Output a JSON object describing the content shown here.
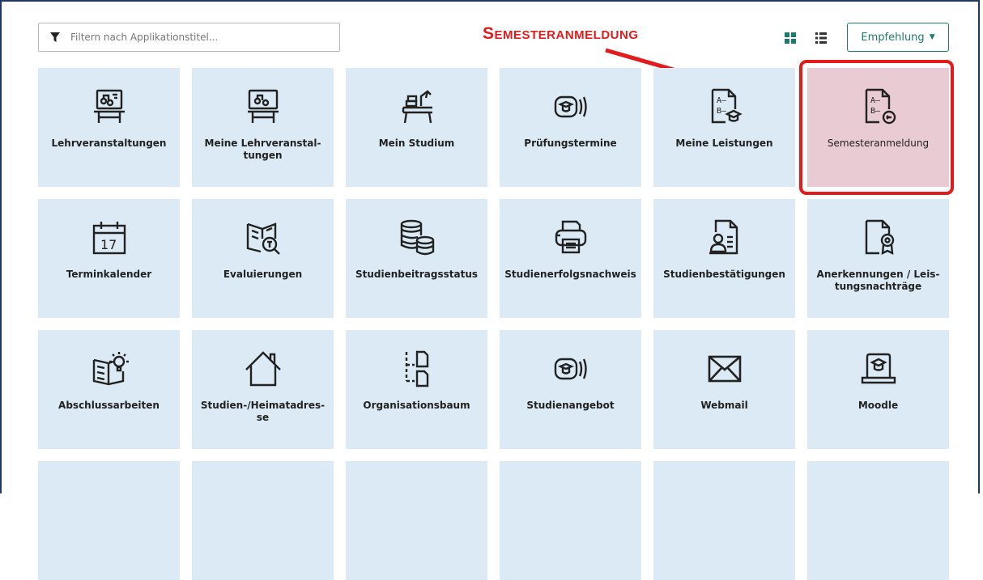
{
  "filter": {
    "placeholder": "Filtern nach Applikationstitel..."
  },
  "annotation": {
    "callout": "Semesteranmeldung"
  },
  "toolbar": {
    "sort_label": "Empfehlung"
  },
  "colors": {
    "tile": "#dbeaf4",
    "highlight_tile": "#e8cbd3",
    "annotation": "#e31b1b",
    "accent": "#1e7a6e"
  },
  "tiles": [
    {
      "label": "Lehrveranstaltungen",
      "icon": "lecture-board-icon"
    },
    {
      "label": "Meine Lehrveranstal-tungen",
      "icon": "my-lecture-board-icon"
    },
    {
      "label": "Mein Studium",
      "icon": "study-desk-icon"
    },
    {
      "label": "Prüfungstermine",
      "icon": "exam-dates-icon"
    },
    {
      "label": "Meine Leistungen",
      "icon": "grades-icon"
    },
    {
      "label": "Semesteranmeldung",
      "icon": "semester-registration-icon"
    },
    {
      "label": "Terminkalender",
      "icon": "calendar-icon",
      "text": "17"
    },
    {
      "label": "Evaluierungen",
      "icon": "evaluation-icon"
    },
    {
      "label": "Studienbeitragsstatus",
      "icon": "coins-icon"
    },
    {
      "label": "Studienerfolgsnachweis",
      "icon": "printer-icon"
    },
    {
      "label": "Studienbestätigungen",
      "icon": "certificate-icon"
    },
    {
      "label": "Anerkennungen / Leis-tungsnachträge",
      "icon": "award-document-icon"
    },
    {
      "label": "Abschlussarbeiten",
      "icon": "thesis-book-icon"
    },
    {
      "label": "Studien-/Heimatadres-se",
      "icon": "house-icon"
    },
    {
      "label": "Organisationsbaum",
      "icon": "org-tree-icon"
    },
    {
      "label": "Studienangebot",
      "icon": "study-offer-icon"
    },
    {
      "label": "Webmail",
      "icon": "envelope-icon"
    },
    {
      "label": "Moodle",
      "icon": "moodle-laptop-icon"
    },
    {
      "label": "",
      "icon": ""
    },
    {
      "label": "",
      "icon": ""
    },
    {
      "label": "",
      "icon": ""
    },
    {
      "label": "",
      "icon": ""
    },
    {
      "label": "",
      "icon": ""
    },
    {
      "label": "",
      "icon": ""
    }
  ]
}
